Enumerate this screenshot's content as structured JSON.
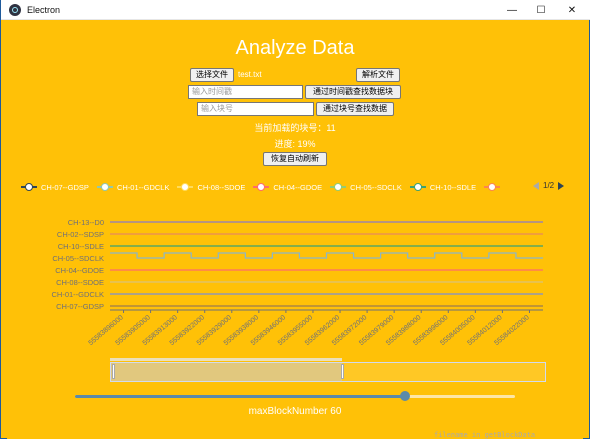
{
  "window": {
    "title": "Electron",
    "minimize_glyph": "—",
    "maximize_glyph": "☐",
    "close_glyph": "✕"
  },
  "page": {
    "title": "Analyze Data"
  },
  "file": {
    "choose_button": "选择文件",
    "filename": "test.txt",
    "parse_button": "解析文件"
  },
  "search": {
    "timestamp_placeholder": "输入时间戳",
    "timestamp_button": "通过时间戳查找数据块",
    "block_placeholder": "输入块号",
    "block_button": "通过块号查找数据"
  },
  "status": {
    "loaded_blocks": "当前加载的块号：11",
    "progress": "进度: 19%",
    "resume_button": "恢复自动刷新"
  },
  "legend": {
    "items": [
      {
        "label": "CH-07--GDSP",
        "color": "#2f4554"
      },
      {
        "label": "CH-01--GDCLK",
        "color": "#91c7ae"
      },
      {
        "label": "CH-08--SDOE",
        "color": "#ffdb5c"
      },
      {
        "label": "CH-04--GDOE",
        "color": "#ff6b6b"
      },
      {
        "label": "CH-05--SDCLK",
        "color": "#91cc75"
      },
      {
        "label": "CH-10--SDLE",
        "color": "#3ba272"
      },
      {
        "label": "",
        "color": "#fc8452"
      }
    ],
    "page_label": "1/2"
  },
  "chart_data": {
    "type": "line",
    "y_categories": [
      "CH-07--GDSP",
      "CH-01--GDCLK",
      "CH-08--SDOE",
      "CH-04--GDOE",
      "CH-05--SDCLK",
      "CH-10--SDLE",
      "CH-02--SDSP",
      "CH-13--D0"
    ],
    "x": [
      "55583896000",
      "55583905000",
      "55583913000",
      "55583922000",
      "55583929000",
      "55583938000",
      "55583946000",
      "55583955000",
      "55583962000",
      "55583972000",
      "55583979000",
      "55583988000",
      "55583996000",
      "55584005000",
      "55584012000",
      "55584022000"
    ],
    "series": [
      {
        "name": "CH-07--GDSP",
        "color": "#9a7b4f",
        "values": [
          0,
          0,
          0,
          0,
          0,
          0,
          0,
          0,
          0,
          0,
          0,
          0,
          0,
          0,
          0,
          0
        ]
      },
      {
        "name": "CH-01--GDCLK",
        "color": "#7a8fd6",
        "values": [
          0,
          0,
          0,
          0,
          0,
          0,
          0,
          0,
          0,
          0,
          0,
          0,
          0,
          0,
          0,
          0
        ]
      },
      {
        "name": "CH-08--SDOE",
        "color": "#d9c27a",
        "values": [
          0,
          0,
          0,
          0,
          0,
          0,
          0,
          0,
          0,
          0,
          0,
          0,
          0,
          0,
          0,
          0
        ]
      },
      {
        "name": "CH-04--GDOE",
        "color": "#ff6b6b",
        "values": [
          0,
          0,
          0,
          0,
          0,
          0,
          0,
          0,
          0,
          0,
          0,
          0,
          0,
          0,
          0,
          0
        ]
      },
      {
        "name": "CH-05--SDCLK",
        "color": "#8ab6c9",
        "values": [
          1,
          0,
          1,
          0,
          1,
          0,
          1,
          0,
          1,
          0,
          1,
          0,
          1,
          0,
          1,
          0
        ]
      },
      {
        "name": "CH-10--SDLE",
        "color": "#3ba272",
        "values": [
          0,
          0,
          0,
          0,
          0,
          0,
          0,
          0,
          0,
          0,
          0,
          0,
          0,
          0,
          0,
          0
        ]
      },
      {
        "name": "CH-02--SDSP",
        "color": "#e88a5c",
        "values": [
          0,
          0,
          0,
          0,
          0,
          0,
          0,
          0,
          0,
          0,
          0,
          0,
          0,
          0,
          0,
          0
        ]
      },
      {
        "name": "CH-13--D0",
        "color": "#8b7bc7",
        "values": [
          0,
          0,
          0,
          0,
          0,
          0,
          0,
          0,
          0,
          0,
          0,
          0,
          0,
          0,
          0,
          0
        ]
      }
    ]
  },
  "zoom": {
    "start_fraction": 0.0,
    "end_fraction": 0.53
  },
  "slider": {
    "value_fraction": 0.75,
    "label": "maxBlockNumber 60"
  },
  "background_terminal": {
    "text": "filename in getBlockData"
  }
}
